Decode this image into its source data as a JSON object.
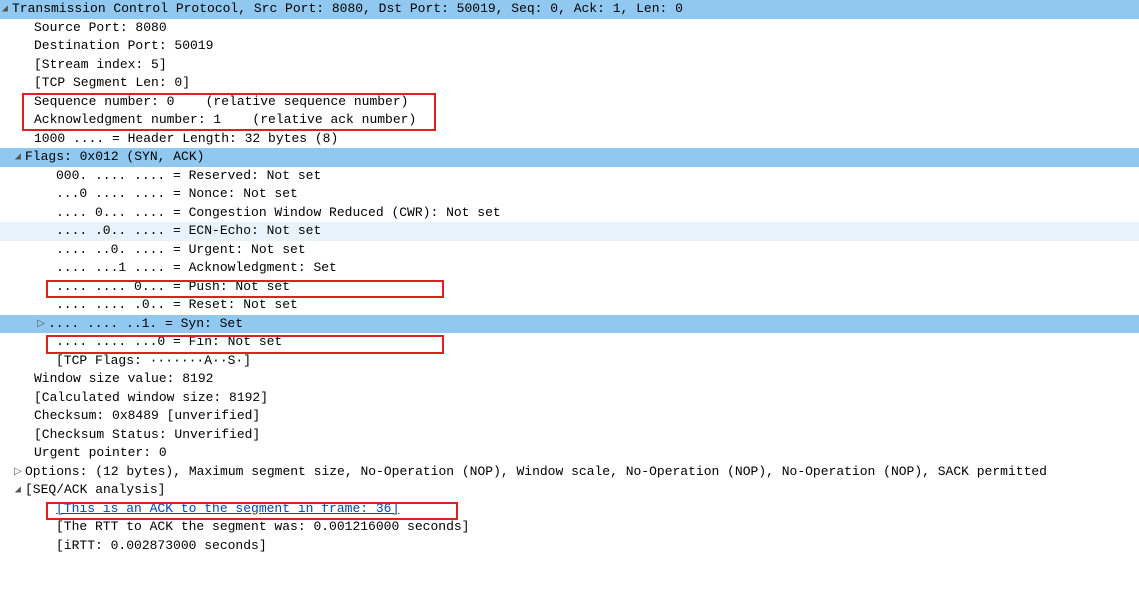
{
  "tcp": {
    "header": "Transmission Control Protocol, Src Port: 8080, Dst Port: 50019, Seq: 0, Ack: 1, Len: 0",
    "src_port": "Source Port: 8080",
    "dst_port": "Destination Port: 50019",
    "stream_idx": "[Stream index: 5]",
    "seg_len": "[TCP Segment Len: 0]",
    "seq_num": "Sequence number: 0    (relative sequence number)",
    "ack_num": "Acknowledgment number: 1    (relative ack number)",
    "hdr_len": "1000 .... = Header Length: 32 bytes (8)"
  },
  "flags": {
    "header": "Flags: 0x012 (SYN, ACK)",
    "reserved": "000. .... .... = Reserved: Not set",
    "nonce": "...0 .... .... = Nonce: Not set",
    "cwr": ".... 0... .... = Congestion Window Reduced (CWR): Not set",
    "ecn": ".... .0.. .... = ECN-Echo: Not set",
    "urgent": ".... ..0. .... = Urgent: Not set",
    "ack": ".... ...1 .... = Acknowledgment: Set",
    "push": ".... .... 0... = Push: Not set",
    "reset": ".... .... .0.. = Reset: Not set",
    "syn": ".... .... ..1. = Syn: Set",
    "fin": ".... .... ...0 = Fin: Not set",
    "tcpflags": "[TCP Flags: ·······A··S·]"
  },
  "win": {
    "size": "Window size value: 8192",
    "calc": "[Calculated window size: 8192]",
    "cksum": "Checksum: 0x8489 [unverified]",
    "cksum_status": "[Checksum Status: Unverified]",
    "urg_ptr": "Urgent pointer: 0",
    "options": "Options: (12 bytes), Maximum segment size, No-Operation (NOP), Window scale, No-Operation (NOP), No-Operation (NOP), SACK permitted"
  },
  "seqack": {
    "header": "[SEQ/ACK analysis]",
    "ack_to": "[This is an ACK to the segment in frame: 36]",
    "rtt": "[The RTT to ACK the segment was: 0.001216000 seconds]",
    "irtt": "[iRTT: 0.002873000 seconds]"
  }
}
